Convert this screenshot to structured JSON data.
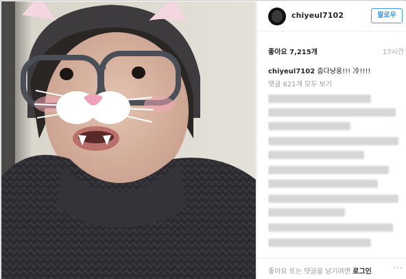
{
  "post": {
    "username": "chiyeul7102",
    "follow_label": "팔로우",
    "likes_text": "좋아요 7,215개",
    "time_text": "17시간",
    "caption_user": "chiyeul7102",
    "caption_text": " 춥다냥옹!!! 冷!!!!",
    "view_all_comments": "댓글 621개 모두 보기",
    "footer_prefix": "좋아요 또는 댓글을 남기려면 ",
    "login_label": "로그인",
    "footer_suffix": ".",
    "more_label": "···"
  },
  "icons": {
    "avatar": "profile-avatar",
    "more": "more-options-icon"
  },
  "colors": {
    "accent": "#3897f0",
    "text": "#262626",
    "muted": "#999999"
  }
}
